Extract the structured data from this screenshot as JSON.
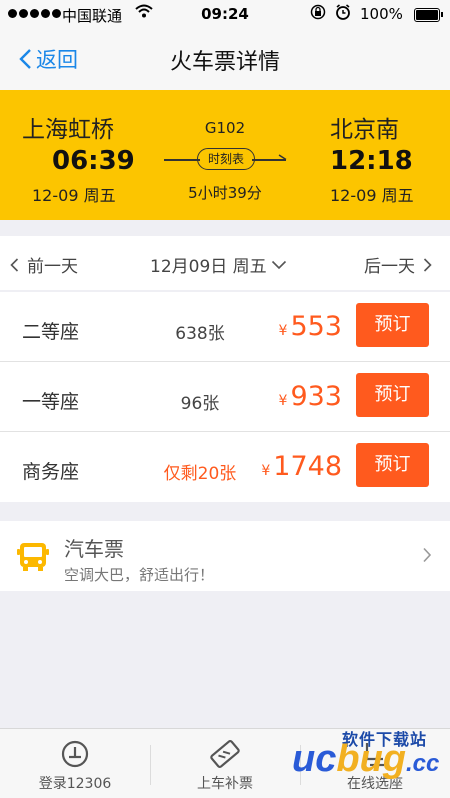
{
  "status_bar": {
    "carrier": "中国联通",
    "time": "09:24",
    "battery": "100%"
  },
  "nav": {
    "back_label": "返回",
    "title": "火车票详情"
  },
  "train": {
    "from_station": "上海虹桥",
    "departure_time": "06:39",
    "departure_date": "12-09 周五",
    "train_number": "G102",
    "schedule_label": "时刻表",
    "duration": "5小时39分",
    "to_station": "北京南",
    "arrival_time": "12:18",
    "arrival_date": "12-09 周五"
  },
  "date_bar": {
    "prev_label": "前一天",
    "current_date": "12月09日 周五",
    "next_label": "后一天"
  },
  "seats": [
    {
      "name": "二等座",
      "count": "638张",
      "yen": "¥",
      "price": "553",
      "book_label": "预订"
    },
    {
      "name": "一等座",
      "count": "96张",
      "yen": "¥",
      "price": "933",
      "book_label": "预订"
    },
    {
      "name": "商务座",
      "count": "仅剩20张",
      "yen": "¥",
      "price": "1748",
      "book_label": "预订"
    }
  ],
  "bus": {
    "title": "汽车票",
    "subtitle": "空调大巴，舒适出行！"
  },
  "tabs": [
    {
      "label": "登录12306",
      "icon": "login-icon"
    },
    {
      "label": "上车补票",
      "icon": "ticket-icon"
    },
    {
      "label": "在线选座",
      "icon": "seat-icon"
    }
  ],
  "watermark": {
    "top_text": "软件下载站",
    "logo_prefix": "uc",
    "logo_mid": "bug",
    "logo_suffix": ".cc"
  },
  "colors": {
    "accent_blue": "#1a87e8",
    "header_yellow": "#fcc500",
    "price_orange": "#ff5a1e"
  }
}
